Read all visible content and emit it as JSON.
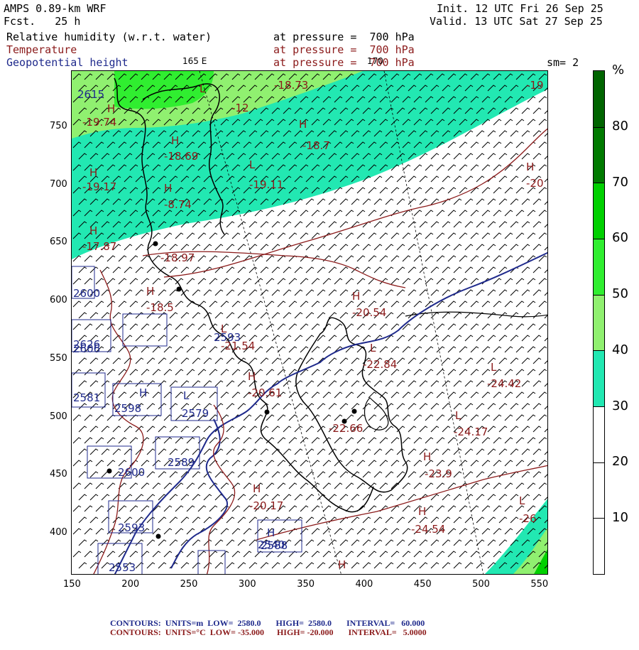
{
  "header": {
    "model": "AMPS 0.89-km WRF",
    "fcst_label": "Fcst.",
    "fcst_value": "25 h",
    "init": "Init. 12 UTC Fri 26 Sep 25",
    "valid": "Valid. 13 UTC Sat 27 Sep 25",
    "field1_name": "Relative humidity (w.r.t. water)",
    "field1_level": "at pressure =  700 hPa",
    "field2_name": "Temperature",
    "field2_level": "at pressure =  700 hPa",
    "field3_name": "Geopotential height",
    "field3_level": "at pressure =  700 hPa",
    "lon_label_1": "165 E",
    "lon_label_2": "170",
    "smoothing": "sm= 2"
  },
  "axes": {
    "x_ticks": [
      "150",
      "200",
      "250",
      "300",
      "350",
      "400",
      "450",
      "500",
      "550"
    ],
    "y_ticks": [
      "750",
      "700",
      "650",
      "600",
      "550",
      "500",
      "450",
      "400"
    ]
  },
  "colorbar": {
    "unit": "%",
    "labels": [
      "80",
      "70",
      "60",
      "50",
      "40",
      "30",
      "20",
      "10"
    ],
    "colors": {
      "c90": "#006400",
      "c80": "#007a00",
      "c70": "#00d000",
      "c60": "#30ee30",
      "c50": "#90f070",
      "c40": "#22e8b2",
      "c0": "#ffffff"
    }
  },
  "map_labels": {
    "temperature": [
      {
        "text": "-18.73"
      },
      {
        "text": "-19.74"
      },
      {
        "text": "-18.69"
      },
      {
        "text": "-18.7"
      },
      {
        "text": "-19"
      },
      {
        "text": "-19.17"
      },
      {
        "text": "-19.11"
      },
      {
        "text": "-8.74"
      },
      {
        "text": "-20"
      },
      {
        "text": "-17.87"
      },
      {
        "text": "-18.97"
      },
      {
        "text": "-18.5"
      },
      {
        "text": "-20.54"
      },
      {
        "text": "-21.54"
      },
      {
        "text": "-22.84"
      },
      {
        "text": "-24.42"
      },
      {
        "text": "-20.61"
      },
      {
        "text": "-22.66"
      },
      {
        "text": "-24.17"
      },
      {
        "text": "-23.9"
      },
      {
        "text": "-20.17"
      },
      {
        "text": "-24.54"
      },
      {
        "text": "-26"
      },
      {
        "text": "-12"
      }
    ],
    "height": [
      {
        "text": "2615"
      },
      {
        "text": "2600"
      },
      {
        "text": "2626"
      },
      {
        "text": "2606"
      },
      {
        "text": "2593"
      },
      {
        "text": "2581"
      },
      {
        "text": "2598"
      },
      {
        "text": "2579"
      },
      {
        "text": "2589"
      },
      {
        "text": "2600"
      },
      {
        "text": "2593"
      },
      {
        "text": "2553"
      },
      {
        "text": "2588"
      },
      {
        "text": "2540"
      }
    ],
    "H": "H",
    "L": "L"
  },
  "footer": {
    "line1_label": "CONTOURS:  UNITS=m  LOW=  2580.0       HIGH=  2580.0       INTERVAL=   60.000",
    "line2_label": "CONTOURS:  UNITS=°C  LOW= -35.000      HIGH= -20.000       INTERVAL=   5.0000"
  }
}
